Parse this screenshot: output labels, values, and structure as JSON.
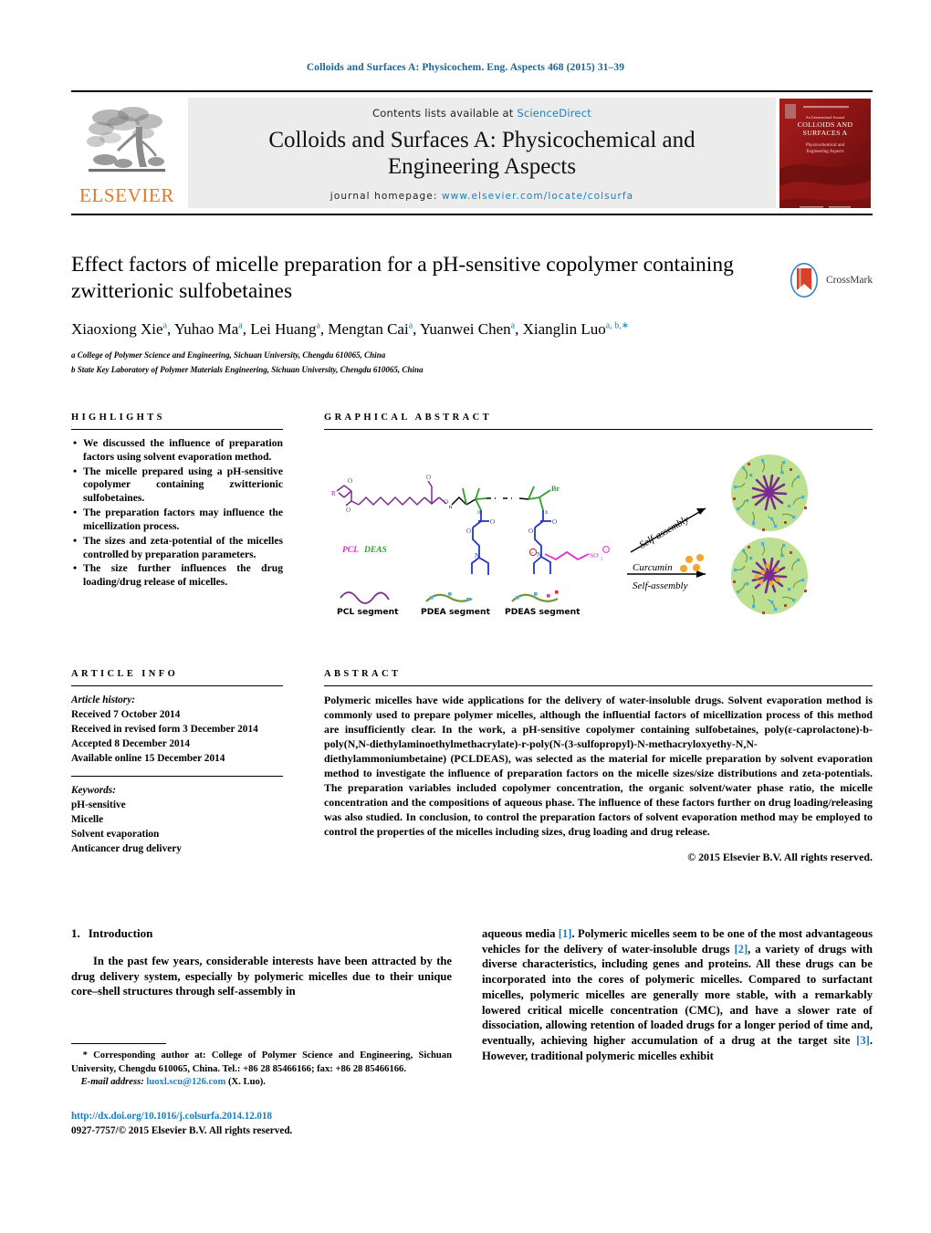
{
  "running_head": "Colloids and Surfaces A: Physicochem. Eng. Aspects 468 (2015) 31–39",
  "masthead": {
    "contents_text": "Contents lists available at ",
    "sciencedirect": "ScienceDirect",
    "journal_title_line1": "Colloids and Surfaces A: Physicochemical and",
    "journal_title_line2": "Engineering Aspects",
    "homepage_label": "journal homepage:",
    "homepage_url": "www.elsevier.com/locate/colsurfa",
    "publisher": "ELSEVIER",
    "cover_line1": "Colloids and",
    "cover_line2": "Surfaces A",
    "cover_line3": "Physicochemical and",
    "cover_line4": "Engineering Aspects"
  },
  "article": {
    "title": "Effect factors of micelle preparation for a pH-sensitive copolymer containing zwitterionic sulfobetaines",
    "authors": "Xiaoxiong Xie a, Yuhao Ma a, Lei Huang a, Mengtan Cai a, Yuanwei Chen a, Xianglin Luo a, b, *",
    "affiliation_a": "a College of Polymer Science and Engineering, Sichuan University, Chengdu 610065, China",
    "affiliation_b": "b State Key Laboratory of Polymer Materials Engineering, Sichuan University, Chengdu 610065, China",
    "crossmark_label": "CrossMark"
  },
  "highlights": {
    "heading": "HIGHLIGHTS",
    "items": [
      "We discussed the influence of preparation factors using solvent evaporation method.",
      "The micelle prepared using a pH-sensitive copolymer containing zwitterionic sulfobetaines.",
      "The preparation factors may influence the micellization process.",
      "The sizes and zeta-potential of the micelles controlled by preparation parameters.",
      "The size further influences the drug loading/drug release of micelles."
    ]
  },
  "graphical_abstract": {
    "heading": "GRAPHICAL ABSTRACT",
    "polymer_label": "PCLDEAS",
    "atom_labels": {
      "r": "R",
      "o1": "O",
      "o2": "O",
      "o3": "O",
      "o4": "O",
      "n": "n",
      "m": "m",
      "x": "x",
      "br": "Br",
      "n_amine": "N",
      "so3": "SO3"
    },
    "legend": [
      "PCL segment",
      "PDEA segment",
      "PDEAS segment"
    ],
    "arrows": [
      "Self-assembly",
      "Curcumin",
      "Self-assembly"
    ]
  },
  "article_info": {
    "heading": "ARTICLE INFO",
    "history_label": "Article history:",
    "history": [
      "Received 7 October 2014",
      "Received in revised form 3 December 2014",
      "Accepted 8 December 2014",
      "Available online 15 December 2014"
    ],
    "keywords_label": "Keywords:",
    "keywords": [
      "pH-sensitive",
      "Micelle",
      "Solvent evaporation",
      "Anticancer drug delivery"
    ]
  },
  "abstract": {
    "heading": "ABSTRACT",
    "body": "Polymeric micelles have wide applications for the delivery of water-insoluble drugs. Solvent evaporation method is commonly used to prepare polymer micelles, although the influential factors of micellization process of this method are insufficiently clear. In the work, a pH-sensitive copolymer containing sulfobetaines, poly(ε-caprolactone)-b-poly(N,N-diethylaminoethylmethacrylate)-r-poly(N-(3-sulfopropyl)-N-methacryloxyethy-N,N-diethylammoniumbetaine) (PCLDEAS), was selected as the material for micelle preparation by solvent evaporation method to investigate the influence of preparation factors on the micelle sizes/size distributions and zeta-potentials. The preparation variables included copolymer concentration, the organic solvent/water phase ratio, the micelle concentration and the compositions of aqueous phase. The influence of these factors further on drug loading/releasing was also studied. In conclusion, to control the preparation factors of solvent evaporation method may be employed to control the properties of the micelles including sizes, drug loading and drug release.",
    "copyright": "© 2015 Elsevier B.V. All rights reserved."
  },
  "introduction": {
    "number": "1.",
    "title": "Introduction",
    "col1": "In the past few years, considerable interests have been attracted by the drug delivery system, especially by polymeric micelles due to their unique core–shell structures through self-assembly in",
    "col2_parts": [
      "aqueous media ",
      "[1]",
      ". Polymeric micelles seem to be one of the most advantageous vehicles for the delivery of water-insoluble drugs ",
      "[2]",
      ", a variety of drugs with diverse characteristics, including genes and proteins. All these drugs can be incorporated into the cores of polymeric micelles. Compared to surfactant micelles, polymeric micelles are generally more stable, with a remarkably lowered critical micelle concentration (CMC), and have a slower rate of dissociation, allowing retention of loaded drugs for a longer period of time and, eventually, achieving higher accumulation of a drug at the target site ",
      "[3]",
      ". However, traditional polymeric micelles exhibit"
    ]
  },
  "footnote": {
    "star": "*",
    "corresponding": "Corresponding author at: College of Polymer Science and Engineering, Sichuan University, Chengdu 610065, China. Tel.: +86 28 85466166; fax: +86 28 85466166.",
    "email_label": "E-mail address:",
    "email": "luoxl.scu@126.com",
    "email_owner": "(X. Luo).",
    "doi": "http://dx.doi.org/10.1016/j.colsurfa.2014.12.018",
    "issn": "0927-7757/© 2015 Elsevier B.V. All rights reserved."
  },
  "colors": {
    "link": "#1a7fc1",
    "elsevier_orange": "#e87722",
    "cover_red": "#8d1414",
    "pcl_purple": "#7d2a8e",
    "pdea_green": "#2ea02e",
    "pdeas_blue": "#2233cc",
    "sulfo_magenta": "#e828c8",
    "micelle_green": "#b9dd8c",
    "curcumin_orange": "#f2a62a"
  }
}
